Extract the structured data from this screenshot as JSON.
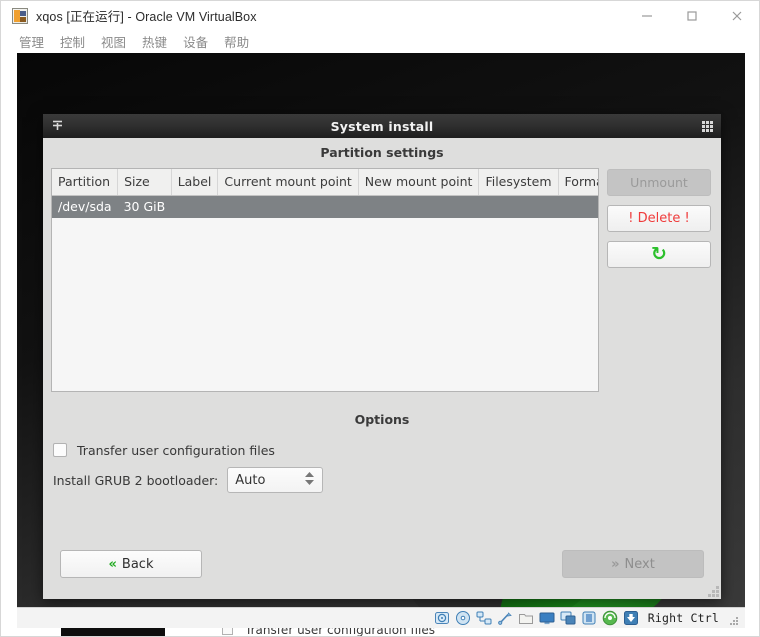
{
  "host": {
    "title": "xqos [正在运行] - Oracle VM VirtualBox",
    "app_icon": "virtualbox-icon",
    "window_controls": {
      "minimize": "minimize-icon",
      "maximize": "maximize-icon",
      "close": "close-icon"
    },
    "menu": [
      {
        "label": "管理"
      },
      {
        "label": "控制"
      },
      {
        "label": "视图"
      },
      {
        "label": "热键"
      },
      {
        "label": "设备"
      },
      {
        "label": "帮助"
      }
    ],
    "statusbar": {
      "icons": [
        "hard-disk-icon",
        "optical-disk-icon",
        "network-icon",
        "usb-icon",
        "shared-folder-icon",
        "display-icon",
        "remote-desktop-icon",
        "recording-icon",
        "mouse-integration-icon",
        "keyboard-capture-icon"
      ],
      "host_key": "Right Ctrl"
    }
  },
  "dialog": {
    "titlebar": {
      "title": "System install",
      "left_icon": "window-menu-icon",
      "right_icon": "grid-dots-icon"
    },
    "partition_section": {
      "heading": "Partition settings",
      "columns": [
        "Partition",
        "Size",
        "Label",
        "Current mount point",
        "New mount point",
        "Filesystem",
        "Format"
      ],
      "rows": [
        {
          "partition": "/dev/sda",
          "size": "30 GiB",
          "label": "",
          "current_mount_point": "",
          "new_mount_point": "",
          "filesystem": "",
          "format": "",
          "selected": true
        }
      ],
      "buttons": [
        {
          "label": "Unmount",
          "state": "disabled",
          "icon": ""
        },
        {
          "label": "! Delete !",
          "state": "enabled",
          "icon": ""
        },
        {
          "label": "",
          "state": "enabled",
          "icon": "refresh-icon",
          "glyph": "↻"
        }
      ]
    },
    "options_section": {
      "heading": "Options",
      "transfer_checkbox": {
        "label": "Transfer user configuration files",
        "checked": false
      },
      "grub": {
        "label": "Install GRUB 2 bootloader:",
        "value": "Auto"
      }
    },
    "footer": {
      "back": {
        "label": "Back",
        "chevron": "«",
        "state": "enabled"
      },
      "next": {
        "label": "Next",
        "chevron": "»",
        "state": "disabled"
      }
    }
  },
  "background": {
    "partial_row_text": "Transfer user configuration files"
  },
  "colors": {
    "dialog_bg": "#dededd",
    "titlebar_dark": "#303030",
    "row_selected": "#7e8285",
    "delete_red": "#ef3b3b",
    "accent_green": "#2cc02c",
    "wallpaper_green": "#2ea02e"
  }
}
